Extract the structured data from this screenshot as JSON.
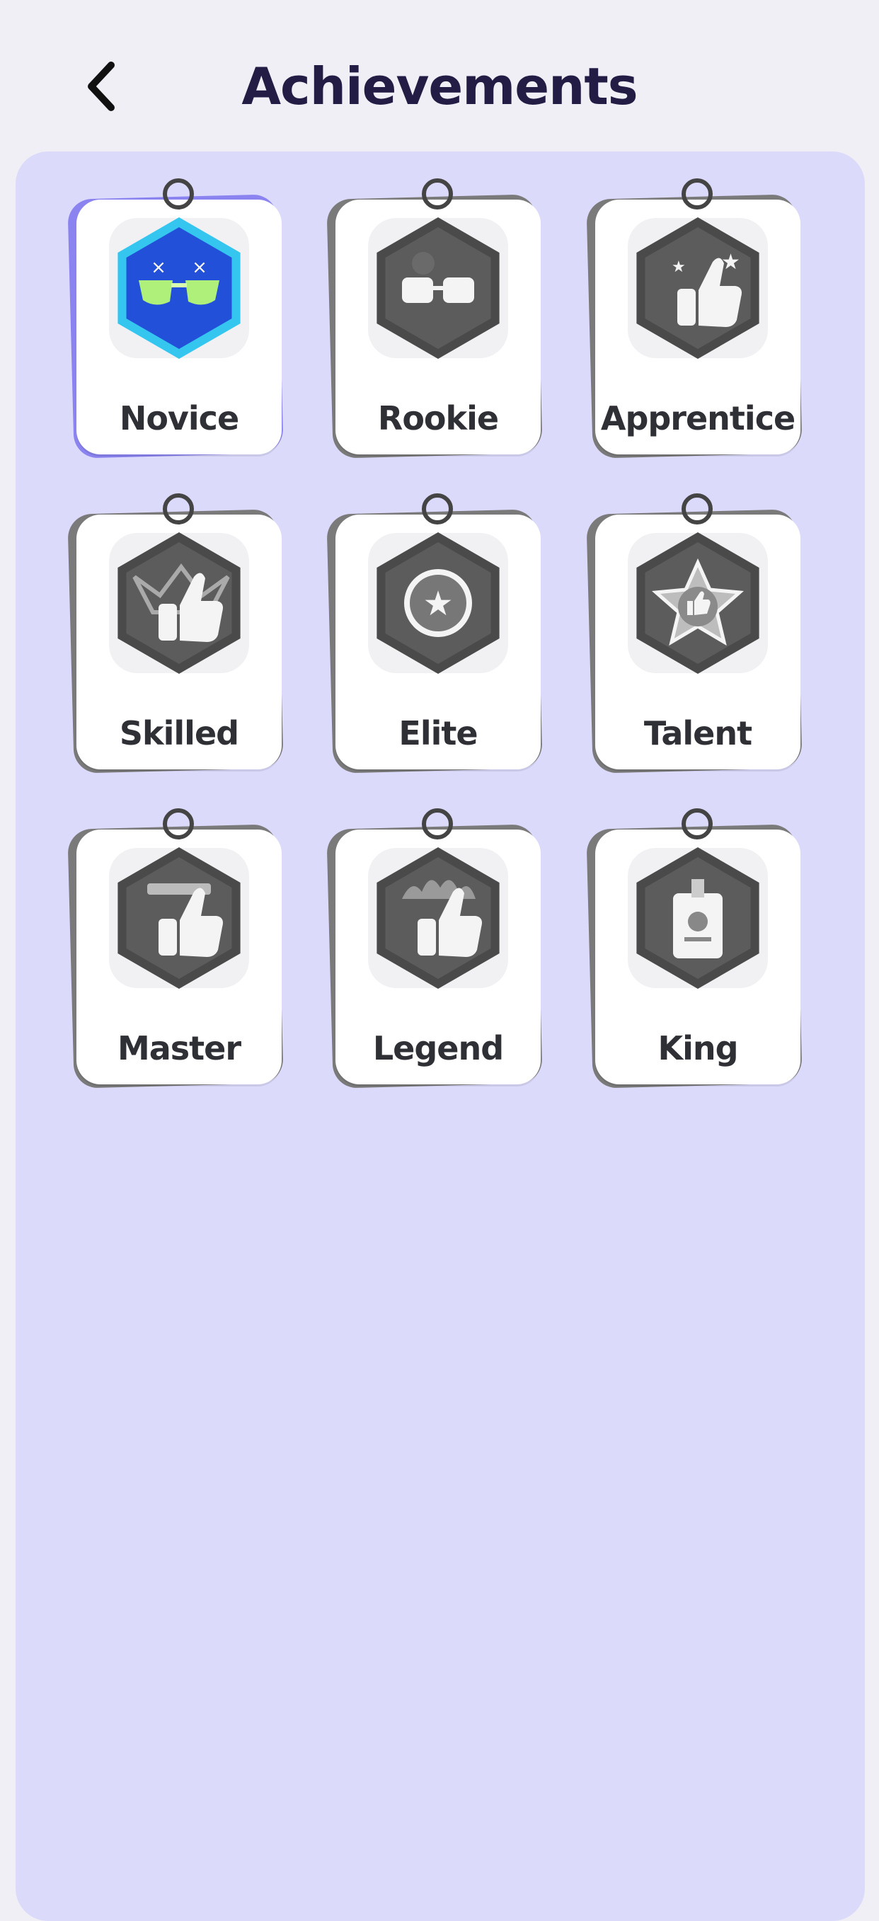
{
  "header": {
    "title": "Achievements",
    "back_icon": "chevron-left-icon"
  },
  "colors": {
    "background": "#efeff5",
    "panel": "#dcdafb",
    "title": "#231d45",
    "unlocked_accent": "#2f6ee8",
    "locked_medal": "#5a5a5a"
  },
  "achievements": [
    {
      "label": "Novice",
      "icon": "sunglasses-face-icon",
      "unlocked": true
    },
    {
      "label": "Rookie",
      "icon": "glasses-icon",
      "unlocked": false
    },
    {
      "label": "Apprentice",
      "icon": "thumbs-up-stars-icon",
      "unlocked": false
    },
    {
      "label": "Skilled",
      "icon": "thumbs-up-crown-icon",
      "unlocked": false
    },
    {
      "label": "Elite",
      "icon": "star-medal-icon",
      "unlocked": false
    },
    {
      "label": "Talent",
      "icon": "thumbs-up-star-badge-icon",
      "unlocked": false
    },
    {
      "label": "Master",
      "icon": "thumbs-up-trophy-icon",
      "unlocked": false
    },
    {
      "label": "Legend",
      "icon": "thumbs-up-flame-icon",
      "unlocked": false
    },
    {
      "label": "King",
      "icon": "id-badge-icon",
      "unlocked": false
    }
  ]
}
